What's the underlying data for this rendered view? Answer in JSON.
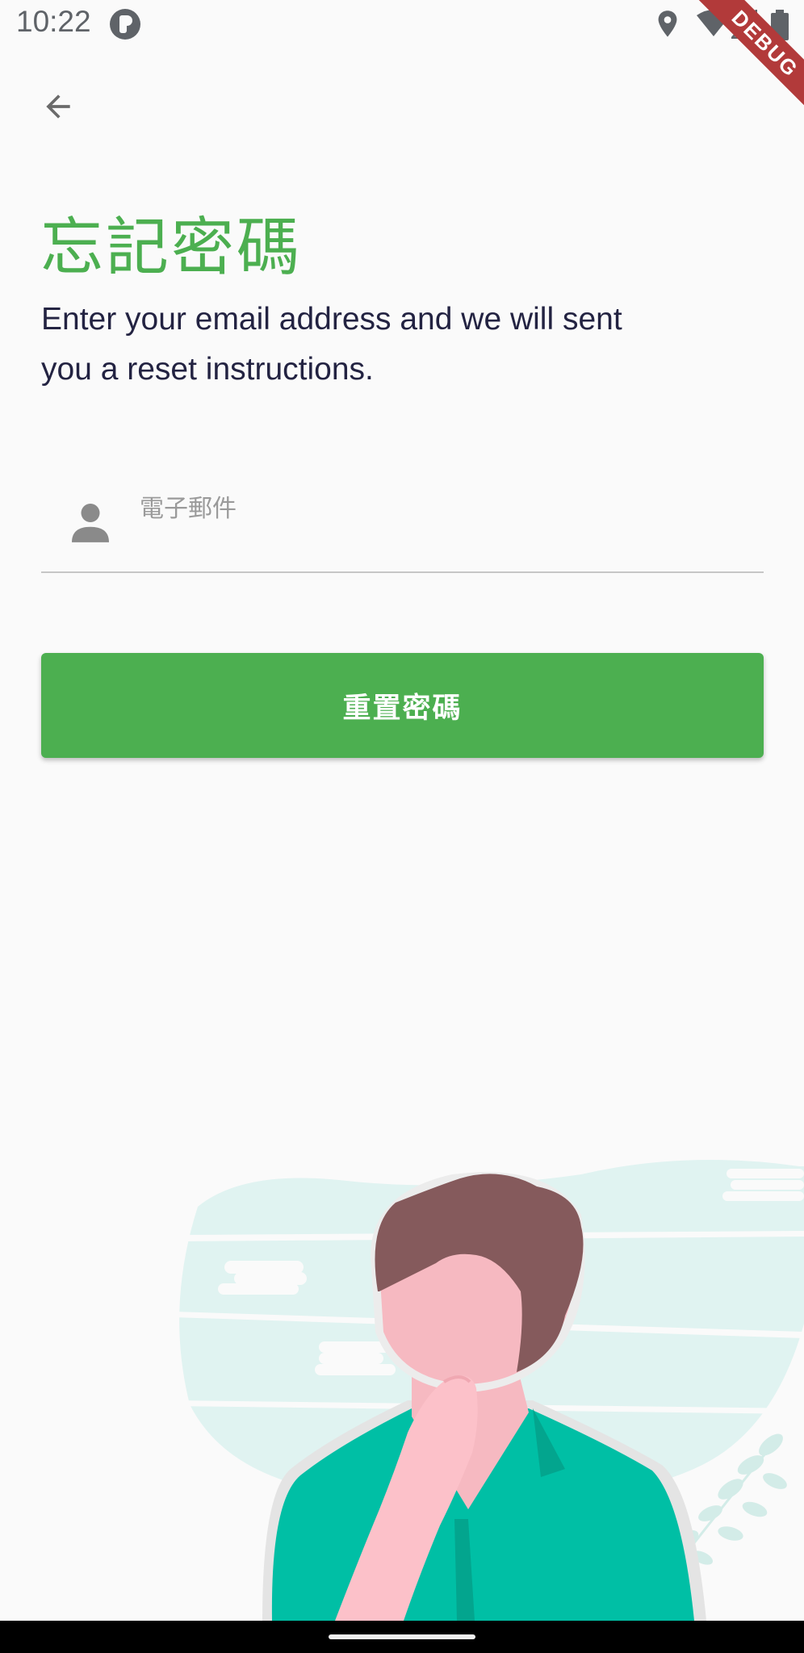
{
  "status_bar": {
    "time": "10:22",
    "icons": [
      "app-notification-icon",
      "location-icon",
      "wifi-icon",
      "signal-icon",
      "battery-icon"
    ]
  },
  "debug_banner": "DEBUG",
  "back_icon": "arrow-back-icon",
  "title": "忘記密碼",
  "subtitle": "Enter your email address and we will sent you a reset instructions.",
  "email_field": {
    "icon": "person-icon",
    "placeholder": "電子郵件",
    "value": ""
  },
  "reset_button_label": "重置密碼",
  "colors": {
    "accent": "#4caf50",
    "background": "#fafafa",
    "text": "#232342",
    "illustration_shirt": "#00bfa5",
    "illustration_hair": "#855a5c",
    "illustration_skin": "#f6b9c1"
  }
}
